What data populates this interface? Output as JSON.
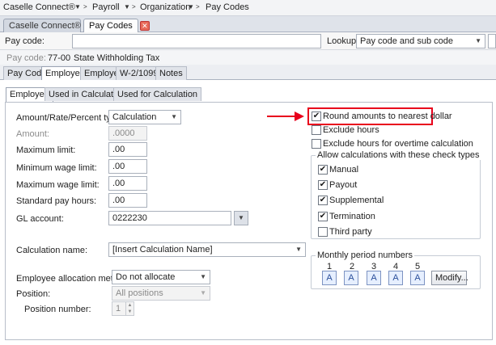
{
  "breadcrumb": {
    "app": "Caselle Connect®",
    "items": [
      "Payroll",
      "Organization",
      "Pay Codes"
    ]
  },
  "doc_tabs": [
    {
      "label": "Caselle Connect®",
      "active": false
    },
    {
      "label": "Pay Codes",
      "active": true
    }
  ],
  "filter": {
    "pay_code_label": "Pay code:",
    "pay_code_value": "",
    "lookup_label": "Lookup:",
    "lookup_value": "Pay code and sub code"
  },
  "info": {
    "label": "Pay code:",
    "code": "77-00",
    "name": "State Withholding Tax"
  },
  "main_tabs": [
    "Pay Code",
    "Employee",
    "Employer",
    "W-2/1099",
    "Notes"
  ],
  "inner_tabs": [
    "Employee",
    "Used in Calculations",
    "Used for Calculation"
  ],
  "form": {
    "amount_type_label": "Amount/Rate/Percent type:",
    "amount_type_value": "Calculation",
    "amount_label": "Amount:",
    "amount_value": ".0000",
    "max_limit_label": "Maximum limit:",
    "max_limit_value": ".00",
    "min_wage_label": "Minimum wage limit:",
    "min_wage_value": ".00",
    "max_wage_label": "Maximum wage limit:",
    "max_wage_value": ".00",
    "std_hours_label": "Standard pay hours:",
    "std_hours_value": ".00",
    "gl_label": "GL account:",
    "gl_value": "0222230",
    "calc_name_label": "Calculation name:",
    "calc_name_value": "[Insert Calculation Name]",
    "alloc_label": "Employee allocation method:",
    "alloc_value": "Do not allocate",
    "position_label": "Position:",
    "position_value": "All positions",
    "position_number_label": "Position number:",
    "position_number_value": "1"
  },
  "options": {
    "round": {
      "label": "Round amounts to nearest dollar",
      "checked": true
    },
    "exclude_hours": {
      "label": "Exclude hours",
      "checked": false
    },
    "exclude_overtime": {
      "label": "Exclude hours for overtime calculation",
      "checked": false
    }
  },
  "check_types": {
    "title": "Allow calculations with these check types",
    "items": [
      {
        "label": "Manual",
        "checked": true
      },
      {
        "label": "Payout",
        "checked": true
      },
      {
        "label": "Supplemental",
        "checked": true
      },
      {
        "label": "Termination",
        "checked": true
      },
      {
        "label": "Third party",
        "checked": false
      }
    ]
  },
  "monthly": {
    "title": "Monthly period numbers",
    "numbers": [
      "1",
      "2",
      "3",
      "4",
      "5"
    ],
    "button_text": "A",
    "modify_label": "Modify..."
  },
  "colors": {
    "highlight": "#e8001c",
    "arrow": "#e8001c"
  },
  "icons": {
    "checked": "✔",
    "dropdown": "▼",
    "close": "✕"
  }
}
